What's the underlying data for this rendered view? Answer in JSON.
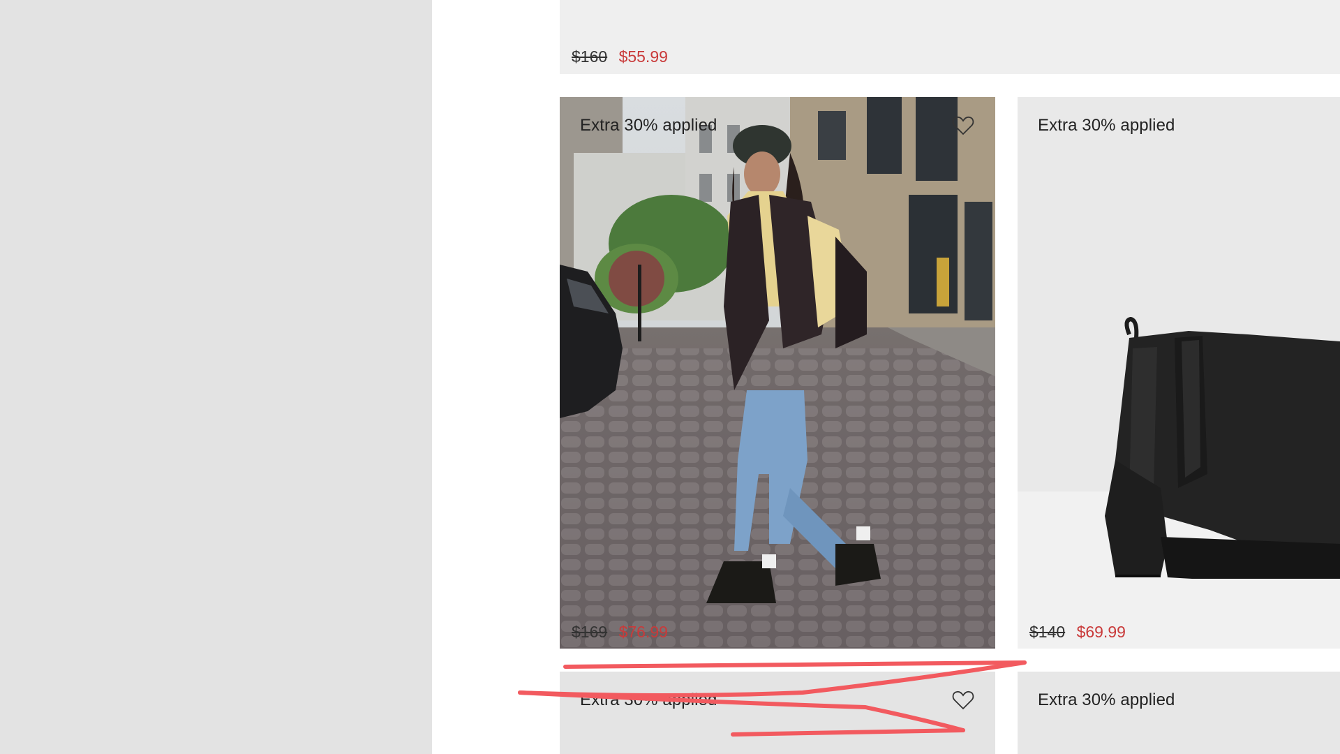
{
  "products": {
    "top": {
      "old_price": "$160",
      "new_price": "$55.99"
    },
    "street": {
      "badge": "Extra 30% applied",
      "old_price": "$169",
      "new_price": "$76.99",
      "favorite_icon": "heart-outline-icon"
    },
    "boot": {
      "badge": "Extra 30% applied",
      "old_price": "$140",
      "new_price": "$69.99"
    },
    "bottom_left": {
      "badge": "Extra 30% applied",
      "favorite_icon": "heart-outline-icon"
    },
    "bottom_right": {
      "badge": "Extra 30% applied"
    }
  },
  "colors": {
    "sale_price": "#c93a3a",
    "annotation_stroke": "#f25a5f",
    "side_panel": "#e3e3e3"
  }
}
